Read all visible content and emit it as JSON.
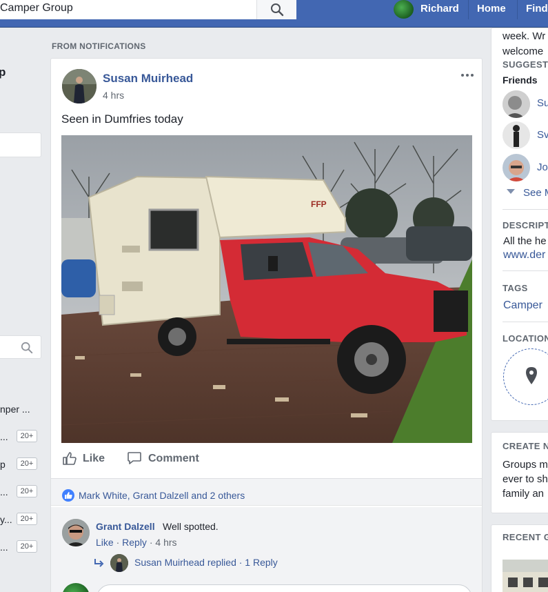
{
  "topbar": {
    "search_value": "Camper Group",
    "user_name": "Richard",
    "nav_home": "Home",
    "nav_find": "Find"
  },
  "left": {
    "partial_heading": "p",
    "items": [
      {
        "label": "nper ...",
        "badge": ""
      },
      {
        "label": "...",
        "badge": "20+"
      },
      {
        "label": "p",
        "badge": "20+"
      },
      {
        "label": "...",
        "badge": "20+"
      },
      {
        "label": "y...",
        "badge": "20+"
      },
      {
        "label": "...",
        "badge": "20+"
      }
    ]
  },
  "feed": {
    "section_label": "FROM NOTIFICATIONS",
    "post": {
      "author": "Susan Muirhead",
      "time": "4 hrs",
      "text": "Seen in Dumfries today",
      "actions": {
        "like": "Like",
        "comment": "Comment"
      },
      "reactions_text": "Mark White, Grant Dalzell and 2 others",
      "comment": {
        "author": "Grant Dalzell",
        "text": "Well spotted.",
        "like": "Like",
        "reply": "Reply",
        "time": "4 hrs",
        "reply_summary": "Susan Muirhead replied · 1 Reply"
      }
    }
  },
  "right": {
    "about_line1": "week. Wr",
    "about_line2": "welcome",
    "suggested_head": "SUGGEST",
    "friends_label": "Friends",
    "friends": [
      "Su",
      "Sv",
      "Jo"
    ],
    "see_more": "See M",
    "description_head": "DESCRIPT",
    "description_line1": "All the he",
    "description_link": "www.der",
    "tags_head": "TAGS",
    "tag": "Camper",
    "location_head": "LOCATION",
    "create_head": "CREATE N",
    "create_line1": "Groups m",
    "create_line2": "ever to sh",
    "create_line3": "family an",
    "recent_head": "RECENT G"
  },
  "colors": {
    "brand_blue": "#4267b2",
    "link_blue": "#385898",
    "page_bg": "#e9ebee"
  },
  "icons": {
    "search": "search-icon",
    "more": "more-options-icon",
    "like": "thumbs-up-icon",
    "comment": "speech-bubble-icon",
    "location": "map-pin-icon",
    "reply": "reply-arrow-icon",
    "see_more": "caret-down-icon"
  }
}
